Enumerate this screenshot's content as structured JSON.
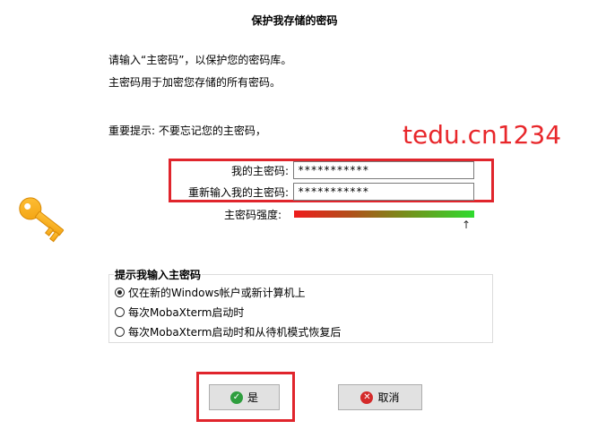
{
  "dialog": {
    "title": "保护我存储的密码",
    "intro_line1": "请输入“主密码”，以保护您的密码库。",
    "intro_line2": "主密码用于加密您存储的所有密码。",
    "tip": "重要提示: 不要忘记您的主密码，"
  },
  "watermark": "tedu.cn1234",
  "fields": {
    "master_password_label": "我的主密码:",
    "master_password_value": "***********",
    "confirm_password_label": "重新输入我的主密码:",
    "confirm_password_value": "***********",
    "strength_label": "主密码强度:",
    "strength_level": 1.0,
    "strength_arrow": "↑"
  },
  "prompt_group": {
    "title": "提示我输入主密码",
    "options": [
      {
        "label": "仅在新的Windows帐户或新计算机上",
        "checked": true
      },
      {
        "label": "每次MobaXterm启动时",
        "checked": false
      },
      {
        "label": "每次MobaXterm启动时和从待机模式恢复后",
        "checked": false
      }
    ]
  },
  "buttons": {
    "ok_label": "是",
    "cancel_label": "取消"
  },
  "colors": {
    "highlight_border": "#e0252c",
    "watermark": "#e8272b",
    "ok_icon": "#2e9e3e",
    "cancel_icon": "#d42a2a"
  },
  "icons": {
    "key": "key-icon",
    "ok": "check-circle-icon",
    "cancel": "x-circle-icon"
  }
}
